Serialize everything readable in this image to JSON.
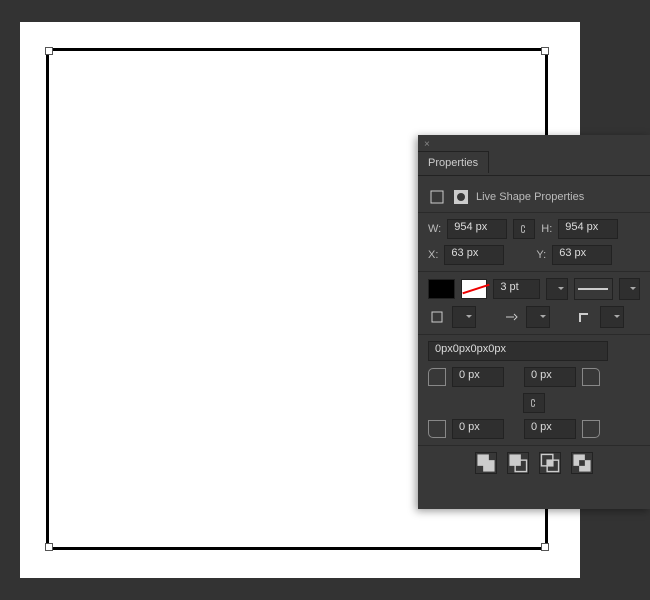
{
  "panel": {
    "title": "Properties",
    "subtitle": "Live Shape Properties",
    "w_label": "W:",
    "h_label": "H:",
    "x_label": "X:",
    "y_label": "Y:",
    "width": "954 px",
    "height": "954 px",
    "x": "63 px",
    "y": "63 px",
    "stroke_weight": "3 pt",
    "corners_summary": "0px0px0px0px",
    "corner_tl": "0 px",
    "corner_tr": "0 px",
    "corner_bl": "0 px",
    "corner_br": "0 px"
  }
}
